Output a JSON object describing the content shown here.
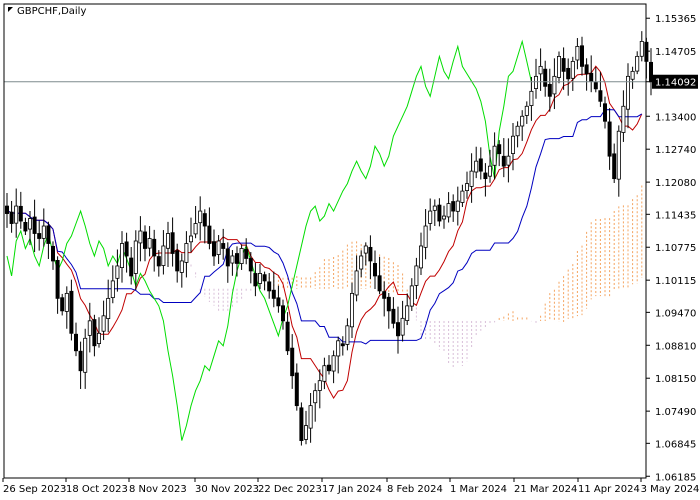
{
  "chart_data": {
    "type": "candlestick",
    "title": "GBPCHF,Daily",
    "current_price": 1.14092,
    "ylim": [
      1.0615,
      1.1565
    ],
    "y_ticks": [
      1.15365,
      1.14705,
      1.14092,
      1.134,
      1.1274,
      1.1208,
      1.11435,
      1.10775,
      1.10115,
      1.0947,
      1.0881,
      1.0815,
      1.0749,
      1.06845,
      1.06185
    ],
    "y_tick_labels": [
      "1.15365",
      "1.14705",
      "1.14092",
      "1.13400",
      "1.12740",
      "1.12080",
      "1.11435",
      "1.10775",
      "1.10115",
      "1.09470",
      "1.08810",
      "1.08150",
      "1.07490",
      "1.06845",
      "1.06185"
    ],
    "x_labels": [
      "26 Sep 2023",
      "18 Oct 2023",
      "8 Nov 2023",
      "30 Nov 2023",
      "22 Dec 2023",
      "17 Jan 2024",
      "8 Feb 2024",
      "1 Mar 2024",
      "21 Mar 2024",
      "11 Apr 2024",
      "3 May 2024"
    ],
    "legend": "none",
    "grid": false,
    "indicator": "Ichimoku Kinko Hyo",
    "colors": {
      "candles": "#000000",
      "tenkan_sen": "#c00000",
      "kijun_sen": "#0000c0",
      "chikou_span": "#00dd00",
      "kumo_bullish": "#f4a460",
      "kumo_bearish": "#d8bfd8",
      "price_line": "#7f8c8d",
      "price_tag_bg": "#000000"
    },
    "close": [
      1.1145,
      1.1125,
      1.116,
      1.113,
      1.111,
      1.1135,
      1.1105,
      1.1095,
      1.112,
      1.1085,
      1.105,
      1.0975,
      1.095,
      1.0985,
      1.0905,
      1.087,
      1.083,
      1.0895,
      1.093,
      1.088,
      1.0905,
      1.094,
      1.0975,
      1.101,
      1.104,
      1.1085,
      1.106,
      1.102,
      1.109,
      1.111,
      1.1075,
      1.1095,
      1.106,
      1.104,
      1.108,
      1.1105,
      1.1065,
      1.103,
      1.105,
      1.1085,
      1.11,
      1.1125,
      1.115,
      1.112,
      1.1085,
      1.106,
      1.109,
      1.1075,
      1.104,
      1.106,
      1.1045,
      1.1075,
      1.1055,
      1.103,
      1.1,
      1.1025,
      1.101,
      1.099,
      1.0975,
      1.096,
      1.093,
      1.087,
      1.082,
      1.076,
      1.069,
      1.072,
      1.076,
      1.079,
      1.081,
      1.084,
      1.083,
      1.086,
      1.089,
      1.088,
      1.092,
      1.0985,
      1.103,
      1.106,
      1.108,
      1.105,
      1.102,
      1.099,
      1.0975,
      1.095,
      1.0925,
      1.09,
      1.0935,
      1.096,
      1.1,
      1.104,
      1.108,
      1.112,
      1.115,
      1.116,
      1.113,
      1.114,
      1.1165,
      1.115,
      1.117,
      1.119,
      1.1205,
      1.123,
      1.125,
      1.123,
      1.1215,
      1.124,
      1.128,
      1.1265,
      1.124,
      1.126,
      1.13,
      1.132,
      1.134,
      1.136,
      1.139,
      1.142,
      1.144,
      1.14,
      1.138,
      1.142,
      1.146,
      1.143,
      1.1415,
      1.145,
      1.148,
      1.144,
      1.1425,
      1.141,
      1.1395,
      1.137,
      1.133,
      1.126,
      1.1215,
      1.131,
      1.136,
      1.142,
      1.143,
      1.146,
      1.149,
      1.145,
      1.1409
    ]
  }
}
